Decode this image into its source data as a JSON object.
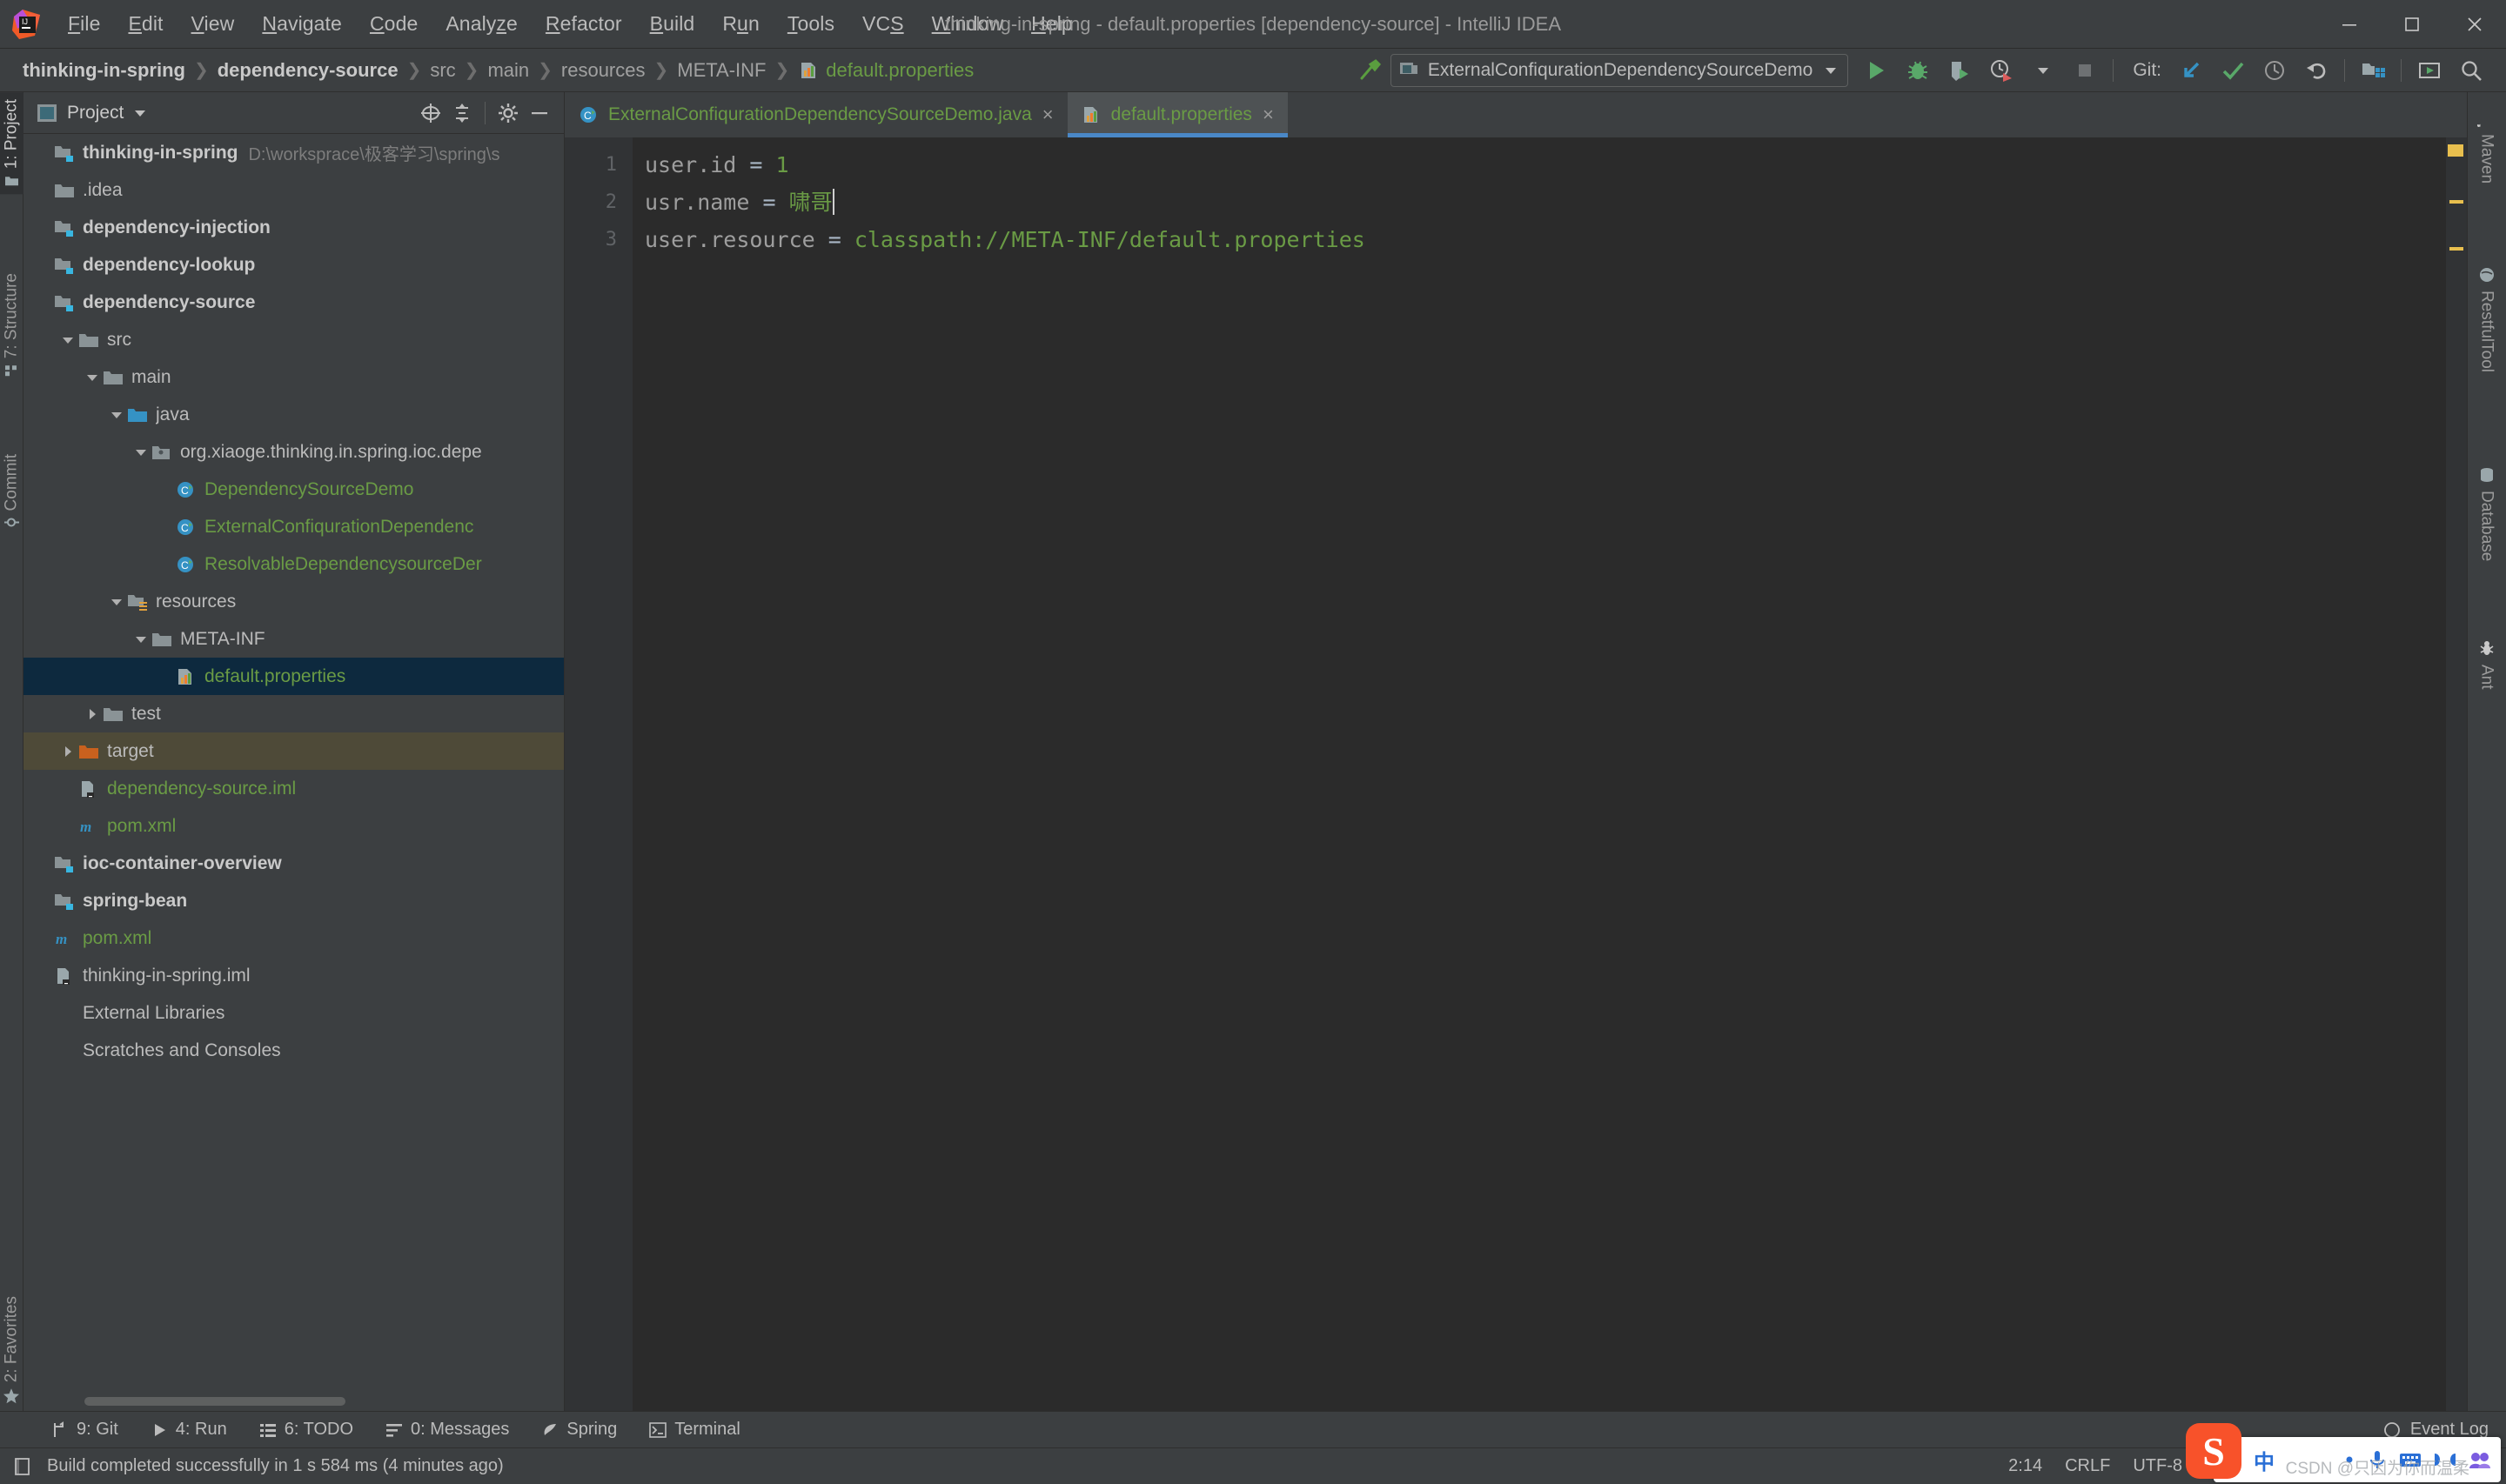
{
  "window": {
    "title": "thinking-in-spring - default.properties [dependency-source] - IntelliJ IDEA",
    "minimize_label": "minimize-window",
    "maximize_label": "maximize-window",
    "close_label": "close-window"
  },
  "menubar": {
    "items": [
      {
        "label": "File",
        "mnemonic": "F"
      },
      {
        "label": "Edit",
        "mnemonic": "E"
      },
      {
        "label": "View",
        "mnemonic": "V"
      },
      {
        "label": "Navigate",
        "mnemonic": "N"
      },
      {
        "label": "Code",
        "mnemonic": "C"
      },
      {
        "label": "Analyze",
        "mnemonic": "z"
      },
      {
        "label": "Refactor",
        "mnemonic": "R"
      },
      {
        "label": "Build",
        "mnemonic": "B"
      },
      {
        "label": "Run",
        "mnemonic": "u"
      },
      {
        "label": "Tools",
        "mnemonic": "T"
      },
      {
        "label": "VCS",
        "mnemonic": "S"
      },
      {
        "label": "Window",
        "mnemonic": "W"
      },
      {
        "label": "Help",
        "mnemonic": "H"
      }
    ]
  },
  "navbar": {
    "breadcrumbs": [
      {
        "label": "thinking-in-spring",
        "style": "bold"
      },
      {
        "label": "dependency-source",
        "style": "bold"
      },
      {
        "label": "src",
        "style": "plain"
      },
      {
        "label": "main",
        "style": "plain"
      },
      {
        "label": "resources",
        "style": "plain"
      },
      {
        "label": "META-INF",
        "style": "plain"
      },
      {
        "label": "default.properties",
        "style": "green",
        "icon": "properties-file-icon"
      }
    ],
    "run_configuration": "ExternalConfiqurationDependencySourceDemo",
    "git_label": "Git:",
    "toolbar_icons": [
      "build-hammer-icon",
      "run-icon",
      "debug-icon",
      "run-with-coverage-icon",
      "profile-icon",
      "dropdown-icon",
      "stop-icon",
      "git-update-icon",
      "git-commit-icon",
      "git-history-icon",
      "git-rollback-icon",
      "project-structure-icon",
      "run-anything-icon",
      "search-everywhere-icon"
    ]
  },
  "left_strip": {
    "items": [
      {
        "label": "1: Project",
        "mnemonic": "1",
        "icon": "project-icon",
        "active": true
      },
      {
        "label": "7: Structure",
        "mnemonic": "7",
        "icon": "structure-icon",
        "active": false
      },
      {
        "label": "Commit",
        "mnemonic": "",
        "icon": "commit-icon",
        "active": false
      },
      {
        "label": "2: Favorites",
        "mnemonic": "2",
        "icon": "star-icon",
        "active": false
      }
    ]
  },
  "right_strip": {
    "items": [
      {
        "label": "Maven",
        "icon": "maven-icon"
      },
      {
        "label": "RestfulTool",
        "icon": "globe-icon"
      },
      {
        "label": "Database",
        "icon": "database-icon"
      },
      {
        "label": "Ant",
        "icon": "ant-icon"
      }
    ]
  },
  "project_panel": {
    "title": "Project",
    "header_icon": "project-window-icon",
    "actions": [
      "select-opened-file-icon",
      "collapse-all-icon",
      "settings-gear-icon",
      "hide-icon"
    ],
    "tree": [
      {
        "indent": 0,
        "arrow": "none",
        "icon": "module-icon",
        "label": "thinking-in-spring",
        "sub": "D:\\worksprace\\极客学习\\spring\\s",
        "style": "bold"
      },
      {
        "indent": 0,
        "arrow": "none",
        "icon": "folder-icon",
        "label": ".idea",
        "style": "normal"
      },
      {
        "indent": 0,
        "arrow": "none",
        "icon": "module-icon",
        "label": "dependency-injection",
        "style": "bold"
      },
      {
        "indent": 0,
        "arrow": "none",
        "icon": "module-icon",
        "label": "dependency-lookup",
        "style": "bold"
      },
      {
        "indent": 0,
        "arrow": "none",
        "icon": "module-icon",
        "label": "dependency-source",
        "style": "bold"
      },
      {
        "indent": 1,
        "arrow": "expanded",
        "icon": "folder-icon",
        "label": "src",
        "style": "normal"
      },
      {
        "indent": 2,
        "arrow": "expanded",
        "icon": "folder-icon",
        "label": "main",
        "style": "normal"
      },
      {
        "indent": 3,
        "arrow": "expanded",
        "icon": "source-folder-icon",
        "label": "java",
        "style": "normal"
      },
      {
        "indent": 4,
        "arrow": "expanded",
        "icon": "package-icon",
        "label": "org.xiaoge.thinking.in.spring.ioc.depe",
        "style": "normal"
      },
      {
        "indent": 5,
        "arrow": "none",
        "icon": "java-class-icon",
        "label": "DependencySourceDemo",
        "style": "green"
      },
      {
        "indent": 5,
        "arrow": "none",
        "icon": "java-class-icon",
        "label": "ExternalConfiqurationDependenc",
        "style": "green"
      },
      {
        "indent": 5,
        "arrow": "none",
        "icon": "java-class-icon",
        "label": "ResolvableDependencysourceDer",
        "style": "green"
      },
      {
        "indent": 3,
        "arrow": "expanded",
        "icon": "resources-folder-icon",
        "label": "resources",
        "style": "normal"
      },
      {
        "indent": 4,
        "arrow": "expanded",
        "icon": "folder-icon",
        "label": "META-INF",
        "style": "normal"
      },
      {
        "indent": 5,
        "arrow": "none",
        "icon": "properties-file-icon",
        "label": "default.properties",
        "style": "green",
        "selected": true
      },
      {
        "indent": 2,
        "arrow": "collapsed",
        "icon": "folder-icon",
        "label": "test",
        "style": "normal"
      },
      {
        "indent": 1,
        "arrow": "collapsed",
        "icon": "excluded-folder-icon",
        "label": "target",
        "style": "normal",
        "highlight": true
      },
      {
        "indent": 1,
        "arrow": "none",
        "icon": "iml-file-icon",
        "label": "dependency-source.iml",
        "style": "green"
      },
      {
        "indent": 1,
        "arrow": "none",
        "icon": "maven-pom-icon",
        "label": "pom.xml",
        "style": "green"
      },
      {
        "indent": 0,
        "arrow": "none",
        "icon": "module-icon",
        "label": "ioc-container-overview",
        "style": "bold"
      },
      {
        "indent": 0,
        "arrow": "none",
        "icon": "module-icon",
        "label": "spring-bean",
        "style": "bold"
      },
      {
        "indent": 0,
        "arrow": "none",
        "icon": "maven-pom-icon",
        "label": "pom.xml",
        "style": "green"
      },
      {
        "indent": 0,
        "arrow": "none",
        "icon": "iml-file-icon",
        "label": "thinking-in-spring.iml",
        "style": "normal"
      },
      {
        "indent": 0,
        "arrow": "none",
        "icon": "none",
        "label": "External Libraries",
        "style": "normal"
      },
      {
        "indent": 0,
        "arrow": "none",
        "icon": "none",
        "label": "Scratches and Consoles",
        "style": "normal"
      }
    ]
  },
  "editor": {
    "tabs": [
      {
        "label": "ExternalConfiqurationDependencySourceDemo.java",
        "icon": "java-class-icon",
        "active": false,
        "close": "×"
      },
      {
        "label": "default.properties",
        "icon": "properties-file-icon",
        "active": true,
        "close": "×"
      }
    ],
    "lines": [
      {
        "number": "1",
        "key": "user.id",
        "eq": " = ",
        "value": "1"
      },
      {
        "number": "2",
        "key": "usr.name",
        "eq": " = ",
        "value": "啸哥",
        "caret": true
      },
      {
        "number": "3",
        "key": "user.resource",
        "eq": " = ",
        "value": "classpath://META-INF/default.properties"
      }
    ]
  },
  "toolwindow_bar": {
    "items": [
      {
        "label": "9: Git",
        "mnemonic": "9",
        "icon": "git-branch-icon"
      },
      {
        "label": "4: Run",
        "mnemonic": "4",
        "icon": "run-icon"
      },
      {
        "label": "6: TODO",
        "mnemonic": "6",
        "icon": "todo-icon"
      },
      {
        "label": "0: Messages",
        "mnemonic": "0",
        "icon": "messages-icon"
      },
      {
        "label": "Spring",
        "mnemonic": "",
        "icon": "spring-leaf-icon"
      },
      {
        "label": "Terminal",
        "mnemonic": "",
        "icon": "terminal-icon"
      }
    ],
    "event_log": "Event Log",
    "event_log_icon": "event-log-icon"
  },
  "status_bar": {
    "message": "Build completed successfully in 1 s 584 ms (4 minutes ago)",
    "message_icon": "build-status-icon",
    "caret_position": "2:14",
    "line_separator": "CRLF",
    "encoding": "UTF-8"
  },
  "ime": {
    "logo": "S",
    "mode_label": "中",
    "icons": [
      "dot-icon",
      "microphone-icon",
      "keyboard-icon",
      "bowtie-icon",
      "panel-icon"
    ]
  },
  "watermark": "CSDN @只因为你而温柔",
  "colors": {
    "accent_blue": "#4a88c7",
    "green_text": "#6a9b45",
    "selection_blue": "#0d293e",
    "excluded_brown": "#4e4a38",
    "panel_bg": "#3c3f41",
    "editor_bg": "#2b2b2b"
  }
}
